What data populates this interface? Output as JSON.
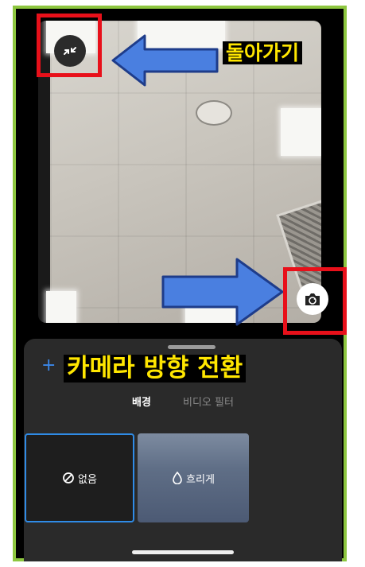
{
  "annotations": {
    "back_label": "돌아가기",
    "switch_camera_label": "카메라 방향 전환"
  },
  "controls": {
    "add_symbol": "+"
  },
  "tabs": [
    {
      "label": "배경",
      "selected": true
    },
    {
      "label": "비디오 필터",
      "selected": false
    }
  ],
  "background_options": [
    {
      "label": "없음",
      "icon": "none-icon",
      "selected": true
    },
    {
      "label": "흐리게",
      "icon": "blur-drop-icon",
      "selected": false
    }
  ],
  "colors": {
    "frame_border": "#8dc63f",
    "highlight_box": "#e8101a",
    "callout_text": "#ffe600",
    "arrow": "#4a7fe0",
    "selection": "#2f8be6"
  }
}
